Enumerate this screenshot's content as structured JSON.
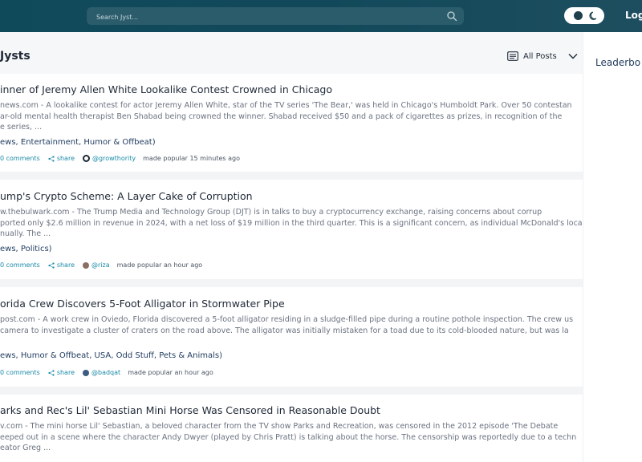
{
  "topbar": {
    "search_placeholder": "Search Jyst...",
    "login_label": "Log"
  },
  "feed": {
    "title": "Jysts",
    "filter_label": "All Posts"
  },
  "sidebar": {
    "leaderboard_label": "Leaderbo"
  },
  "posts": [
    {
      "title": "inner of Jeremy Allen White Lookalike Contest Crowned in Chicago",
      "excerpt": [
        "news.com - A lookalike contest for actor Jeremy Allen White, star of the TV series 'The Bear,' was held in Chicago's Humboldt Park. Over 50 contestan",
        "ar-old mental health therapist Ben Shabad being crowned the winner. Shabad received $50 and a pack of cigarettes as prizes, in recognition of the",
        "e series, ..."
      ],
      "tags": "ews, Entertainment, Humor & Offbeat)",
      "comments": "0 comments",
      "share": "share",
      "user": "@growthority",
      "popular": "made popular 15 minutes ago"
    },
    {
      "title": "ump's Crypto Scheme: A Layer Cake of Corruption",
      "excerpt": [
        "w.thebulwark.com - The Trump Media and Technology Group (DJT) is in talks to buy a cryptocurrency exchange, raising concerns about corrup",
        "ported only $2.6 million in revenue in 2024, with a net loss of $19 million in the third quarter. This is a significant concern, as individual McDonald's loca",
        "nually. The ..."
      ],
      "tags": "ews, Politics)",
      "comments": "0 comments",
      "share": "share",
      "user": "@riza",
      "popular": "made popular an hour ago"
    },
    {
      "title": "orida Crew Discovers 5-Foot Alligator in Stormwater Pipe",
      "excerpt": [
        "post.com - A work crew in Oviedo, Florida discovered a 5-foot alligator residing in a sludge-filled pipe during a routine pothole inspection. The crew us",
        "camera to investigate a cluster of craters on the road above. The alligator was initially mistaken for a toad due to its cold-blooded nature, but was la",
        ""
      ],
      "tags": "ews, Humor & Offbeat, USA, Odd Stuff, Pets & Animals)",
      "comments": "0 comments",
      "share": "share",
      "user": "@badqat",
      "popular": "made popular an hour ago"
    },
    {
      "title": "arks and Rec's Lil' Sebastian Mini Horse Was Censored in Reasonable Doubt",
      "excerpt": [
        "v.com - The mini horse Lil' Sebastian, a beloved character from the TV show Parks and Recreation, was censored in the 2012 episode 'The Debate",
        "eeped out in a scene where the character Andy Dwyer (played by Chris Pratt) is talking about the horse. The censorship was reportedly due to a techn",
        "eator Greg ..."
      ]
    }
  ]
}
